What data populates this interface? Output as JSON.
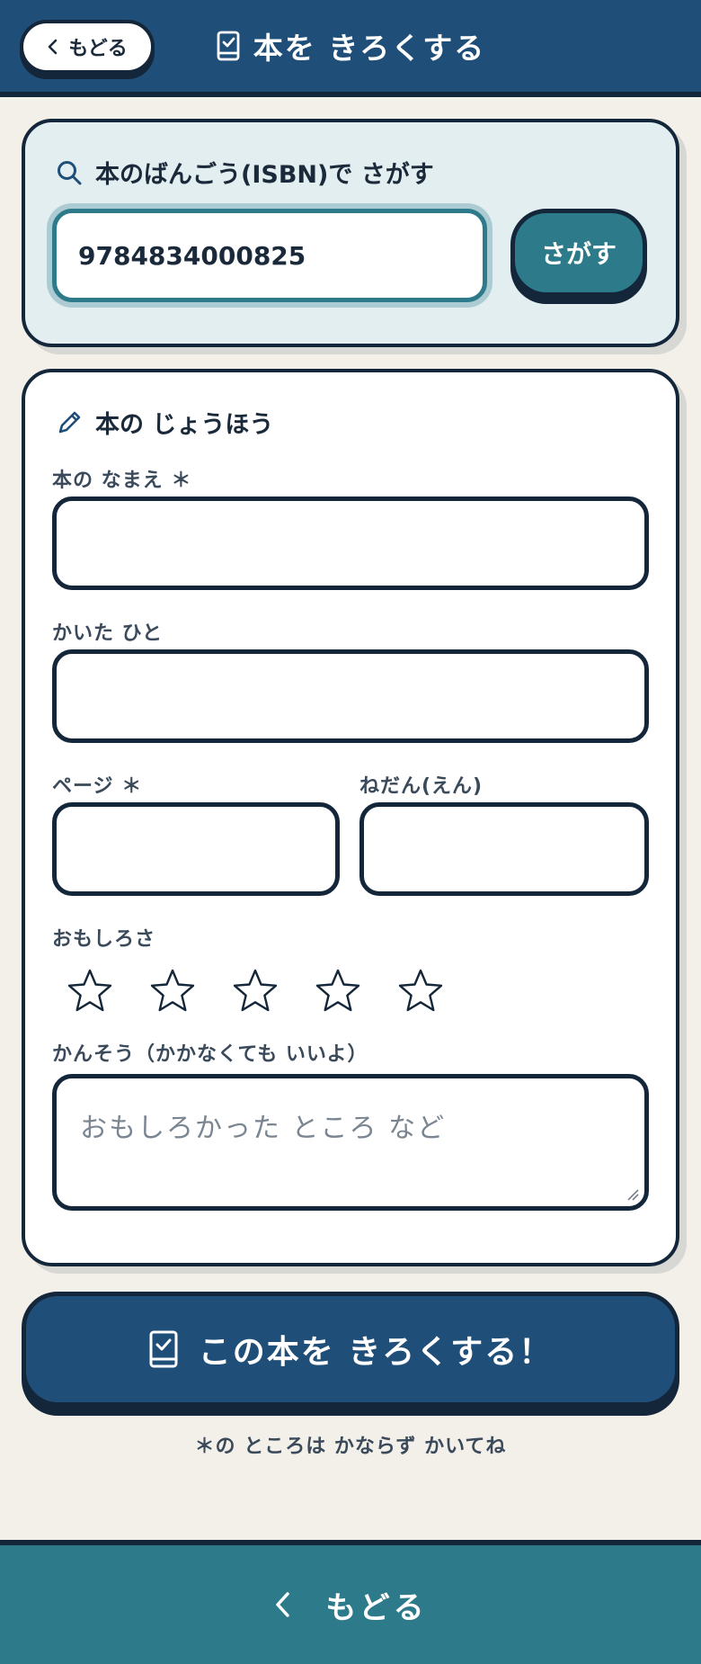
{
  "header": {
    "back_label": "もどる",
    "title": "本を きろくする"
  },
  "search": {
    "title": "本のばんごう(ISBN)で さがす",
    "isbn_value": "9784834000825",
    "button_label": "さがす"
  },
  "info": {
    "title": "本の じょうほう",
    "title_label": "本の なまえ ＊",
    "author_label": "かいた ひと",
    "pages_label": "ページ ＊",
    "price_label": "ねだん(えん)",
    "rating_label": "おもしろさ",
    "rating_value": 0,
    "rating_max": 5,
    "review_label": "かんそう（かかなくても いいよ）",
    "review_placeholder": "おもしろかった ところ など"
  },
  "submit": {
    "label": "この本を きろくする！"
  },
  "footnote": "＊の ところは かならず かいてね",
  "bottom": {
    "back_label": "もどる"
  },
  "colors": {
    "header": "#1f4e78",
    "accent": "#2d7a8a",
    "dark": "#14263a",
    "background": "#f3efe9"
  }
}
